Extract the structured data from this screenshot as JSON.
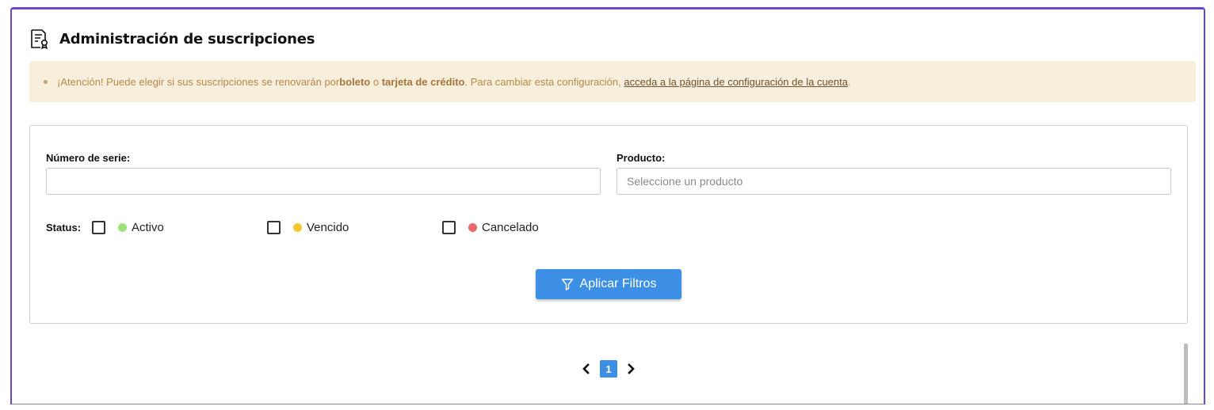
{
  "header": {
    "title": "Administración de suscripciones",
    "icon": "certificate-document-icon"
  },
  "alert": {
    "prefix": "¡Atención! Puede elegir si sus suscripciones se renovarán por ",
    "option1": "boleto",
    "connector": " o ",
    "option2": "tarjeta de crédito",
    "middle": ". Para cambiar esta configuración, ",
    "link": "acceda a la página de configuración de la cuenta",
    "suffix": "."
  },
  "filters": {
    "serial_label": "Número de serie:",
    "serial_value": "",
    "product_label": "Producto:",
    "product_placeholder": "Seleccione un producto",
    "status_label": "Status:",
    "statuses": [
      {
        "label": "Activo",
        "color": "#9be27a",
        "checked": false
      },
      {
        "label": "Vencido",
        "color": "#f2c62f",
        "checked": false
      },
      {
        "label": "Cancelado",
        "color": "#e86a6a",
        "checked": false
      }
    ],
    "apply_label": "Aplicar Filtros"
  },
  "pagination": {
    "current_page": "1",
    "prev_icon": "chevron-left-icon",
    "next_icon": "chevron-right-icon"
  },
  "colors": {
    "accent": "#6b46d6",
    "primary": "#3d8fe6",
    "alert_bg": "#f7eedb",
    "alert_text": "#b8894a"
  }
}
